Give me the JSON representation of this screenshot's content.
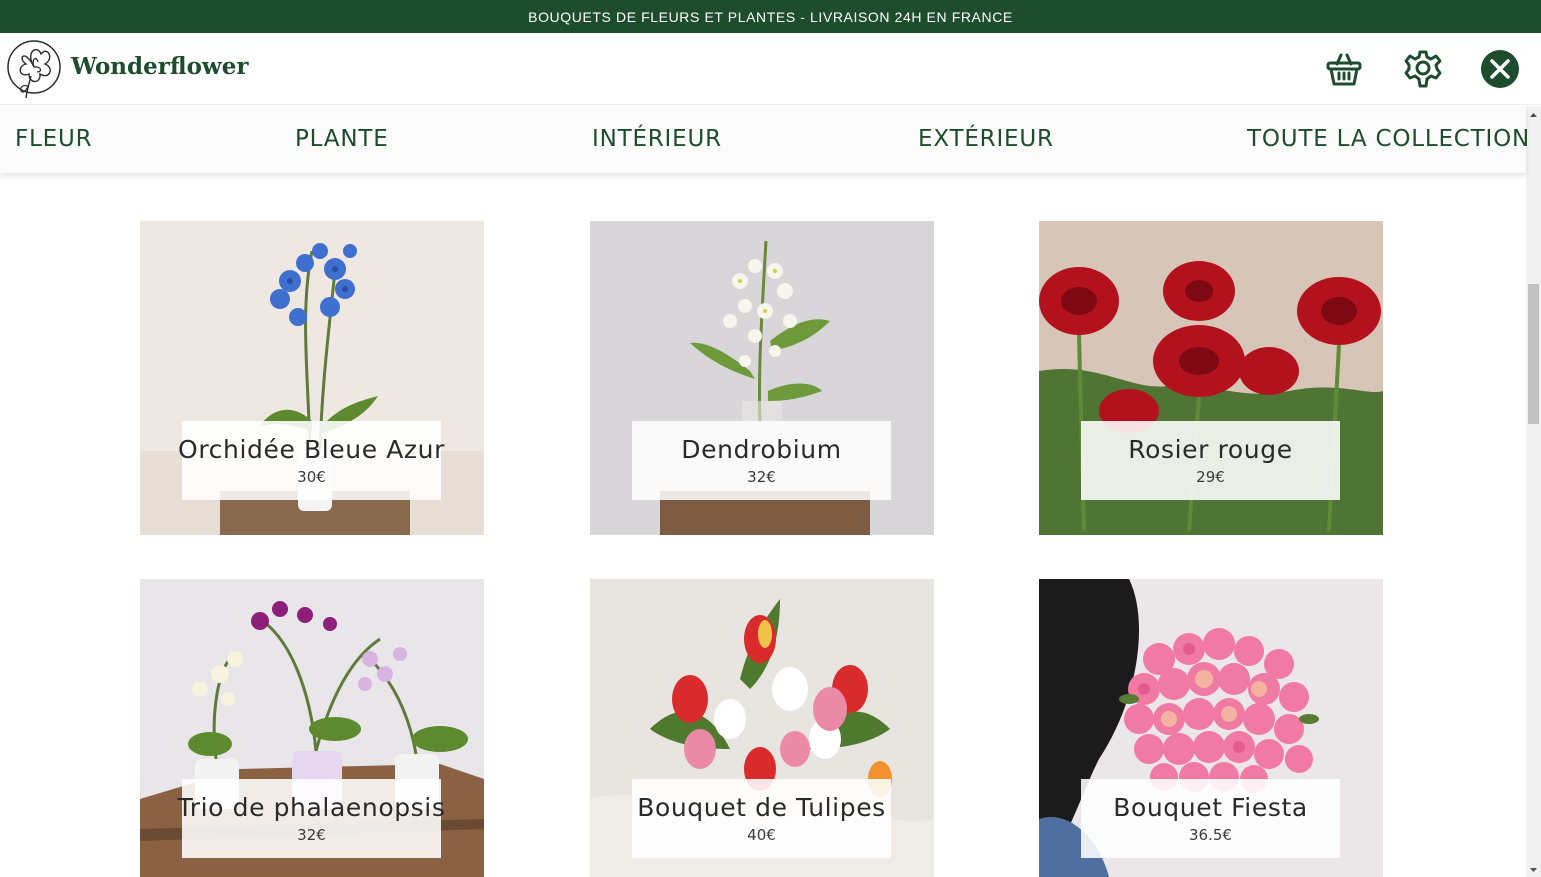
{
  "promo": {
    "text": "BOUQUETS DE FLEURS ET PLANTES - LIVRAISON 24H EN FRANCE"
  },
  "header": {
    "brand": "Wonderflower",
    "icons": {
      "basket": "basket-icon",
      "settings": "gear-icon",
      "close": "close-icon"
    }
  },
  "nav": {
    "items": [
      {
        "label": "FLEUR"
      },
      {
        "label": "PLANTE"
      },
      {
        "label": "INTÉRIEUR"
      },
      {
        "label": "EXTÉRIEUR"
      },
      {
        "label": "TOUTE LA COLLECTION"
      }
    ]
  },
  "products": [
    {
      "name": "Orchidée Bleue Azur",
      "price": "30€"
    },
    {
      "name": "Dendrobium",
      "price": "32€"
    },
    {
      "name": "Rosier rouge",
      "price": "29€"
    },
    {
      "name": "Trio de phalaenopsis",
      "price": "32€"
    },
    {
      "name": "Bouquet de Tulipes",
      "price": "40€"
    },
    {
      "name": "Bouquet Fiesta",
      "price": "36.5€"
    }
  ],
  "colors": {
    "brand_green": "#1d4d2d",
    "promo_bg": "#1d4d2d",
    "caption_bg": "#ffffff"
  }
}
